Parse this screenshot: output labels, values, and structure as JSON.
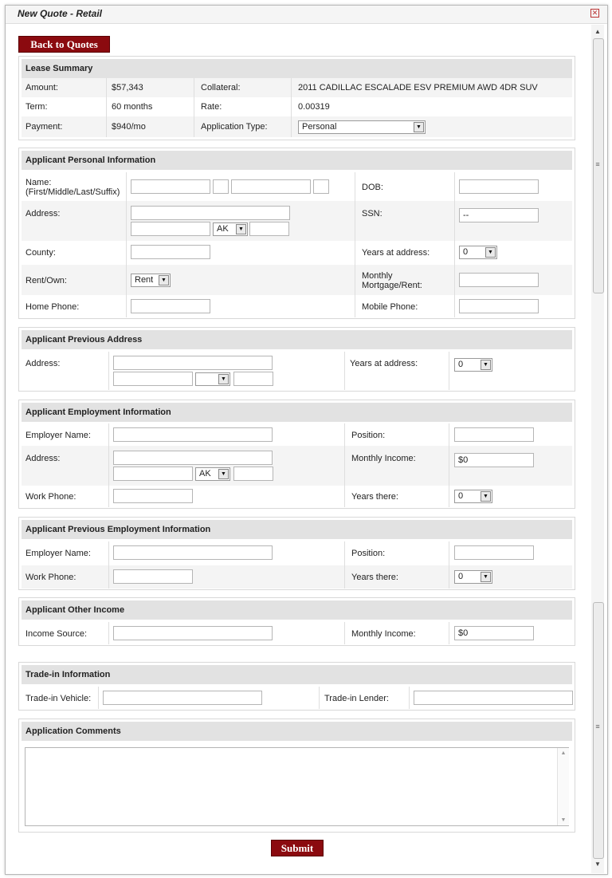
{
  "window": {
    "title": "New Quote - Retail",
    "close_glyph": "✕"
  },
  "back_button": "Back to Quotes",
  "submit_button": "Submit",
  "icons": {
    "close": "close-icon",
    "dropdown": "chevron-down-icon",
    "scroll_up": "scroll-up-icon",
    "scroll_down": "scroll-down-icon"
  },
  "lease_summary": {
    "title": "Lease Summary",
    "amount_label": "Amount:",
    "amount": "$57,343",
    "collateral_label": "Collateral:",
    "collateral": "2011 CADILLAC ESCALADE ESV PREMIUM AWD 4DR SUV",
    "term_label": "Term:",
    "term": "60 months",
    "rate_label": "Rate:",
    "rate": "0.00319",
    "payment_label": "Payment:",
    "payment": "$940/mo",
    "app_type_label": "Application Type:",
    "app_type": "Personal"
  },
  "personal": {
    "title": "Applicant Personal Information",
    "name_label": "Name:",
    "name_sub": "(First/Middle/Last/Suffix)",
    "dob_label": "DOB:",
    "address_label": "Address:",
    "state": "AK",
    "ssn_label": "SSN:",
    "ssn_value": "--",
    "county_label": "County:",
    "years_label": "Years at address:",
    "years_value": "0",
    "rent_own_label": "Rent/Own:",
    "rent_own_value": "Rent",
    "mortgage_label_1": "Monthly",
    "mortgage_label_2": "Mortgage/Rent:",
    "home_phone_label": "Home Phone:",
    "mobile_phone_label": "Mobile Phone:"
  },
  "previous_address": {
    "title": "Applicant Previous Address",
    "address_label": "Address:",
    "state": "",
    "years_label": "Years at address:",
    "years_value": "0"
  },
  "employment": {
    "title": "Applicant Employment Information",
    "employer_label": "Employer Name:",
    "position_label": "Position:",
    "address_label": "Address:",
    "state": "AK",
    "income_label": "Monthly Income:",
    "income_value": "$0",
    "work_phone_label": "Work Phone:",
    "years_label": "Years there:",
    "years_value": "0"
  },
  "previous_employment": {
    "title": "Applicant Previous Employment Information",
    "employer_label": "Employer Name:",
    "position_label": "Position:",
    "work_phone_label": "Work Phone:",
    "years_label": "Years there:",
    "years_value": "0"
  },
  "other_income": {
    "title": "Applicant Other Income",
    "source_label": "Income Source:",
    "income_label": "Monthly Income:",
    "income_value": "$0"
  },
  "trade_in": {
    "title": "Trade-in Information",
    "vehicle_label": "Trade-in Vehicle:",
    "lender_label": "Trade-in Lender:"
  },
  "comments": {
    "title": "Application Comments"
  }
}
